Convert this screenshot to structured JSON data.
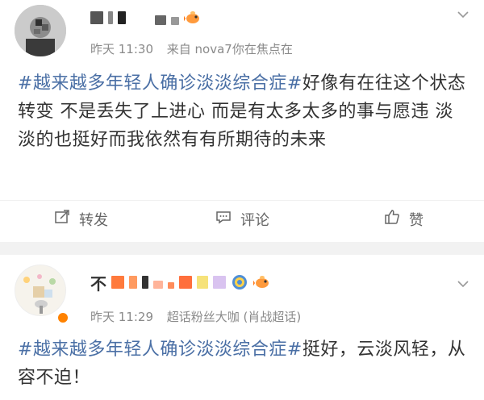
{
  "posts": [
    {
      "meta": {
        "time": "昨天 11:30",
        "source": "来自 nova7你在焦点在"
      },
      "content": {
        "hashtag": "#越来越多年轻人确诊淡淡综合症#",
        "text": "好像有在往这个状态转变 不是丢失了上进心 而是有太多太多的事与愿违 淡淡的也挺好而我依然有有所期待的未来"
      },
      "actions": {
        "repost": "转发",
        "comment": "评论",
        "like": "赞"
      }
    },
    {
      "meta": {
        "time": "昨天 11:29",
        "source": "超话粉丝大咖 (肖战超话)"
      },
      "content": {
        "hashtag": "#越来越多年轻人确诊淡淡综合症#",
        "text": "挺好，云淡风轻，从容不迫！"
      }
    }
  ],
  "name_prefix_2": "不",
  "colors": {
    "hashtag": "#4a6fa5",
    "divider": "#f2f2f2",
    "meta": "#8a8a8a",
    "verified": "#ff8200"
  },
  "icons": [
    "chevron-down-icon",
    "repost-icon",
    "comment-icon",
    "like-icon",
    "fish-emoji-icon",
    "verified-icon"
  ]
}
